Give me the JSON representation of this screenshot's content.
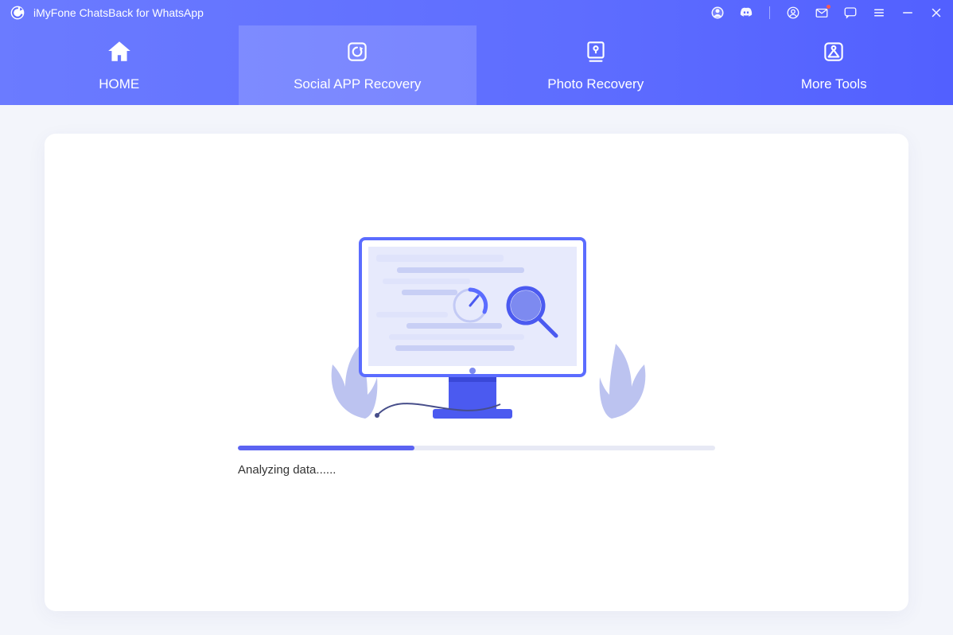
{
  "titlebar": {
    "title": "iMyFone ChatsBack for WhatsApp"
  },
  "nav": {
    "items": [
      {
        "label": "HOME"
      },
      {
        "label": "Social APP Recovery"
      },
      {
        "label": "Photo Recovery"
      },
      {
        "label": "More Tools"
      }
    ],
    "active_index": 1
  },
  "progress": {
    "percent": 37,
    "status_text": "Analyzing data......"
  }
}
